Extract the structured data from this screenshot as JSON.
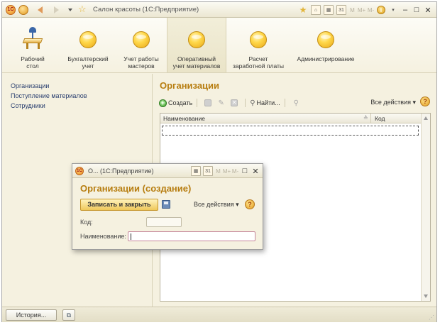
{
  "window": {
    "title": "Салон красоты  (1С:Предприятие)",
    "toolbar_right": [
      "M",
      "M+",
      "M-"
    ]
  },
  "sections": [
    {
      "label": "Рабочий\nстол",
      "icon": "desk-lamp-icon",
      "active": false
    },
    {
      "label": "Бухгалтерский\nучет",
      "icon": "yellow-circle-icon",
      "active": false
    },
    {
      "label": "Учет работы\nмастеров",
      "icon": "yellow-circle-icon",
      "active": false
    },
    {
      "label": "Оперативный\nучет материалов",
      "icon": "yellow-circle-icon",
      "active": true
    },
    {
      "label": "Расчет\nзаработной платы",
      "icon": "yellow-circle-icon",
      "active": false
    },
    {
      "label": "Администрирование",
      "icon": "yellow-circle-icon",
      "active": false
    }
  ],
  "sidebar": {
    "items": [
      {
        "label": "Организации"
      },
      {
        "label": "Поступление материалов"
      },
      {
        "label": "Сотрудники"
      }
    ]
  },
  "list_form": {
    "title": "Организации",
    "toolbar": {
      "create_label": "Создать",
      "find_label": "Найти...",
      "all_actions_label": "Все действия ▾",
      "help_label": "?"
    },
    "columns": [
      "Наименование",
      "Код"
    ]
  },
  "dialog": {
    "window_title": "О...  (1С:Предприятие)",
    "heading": "Организации (создание)",
    "save_close_label": "Записать и закрыть",
    "all_actions_label": "Все действия ▾",
    "help_label": "?",
    "fields": [
      {
        "label": "Код:",
        "value": ""
      },
      {
        "label": "Наименование:",
        "value": ""
      }
    ]
  },
  "statusbar": {
    "history_label": "История..."
  },
  "colors": {
    "accent_title": "#b77d0f",
    "panel_bg": "#f5f1e0",
    "link_text": "#2a3f6f"
  }
}
